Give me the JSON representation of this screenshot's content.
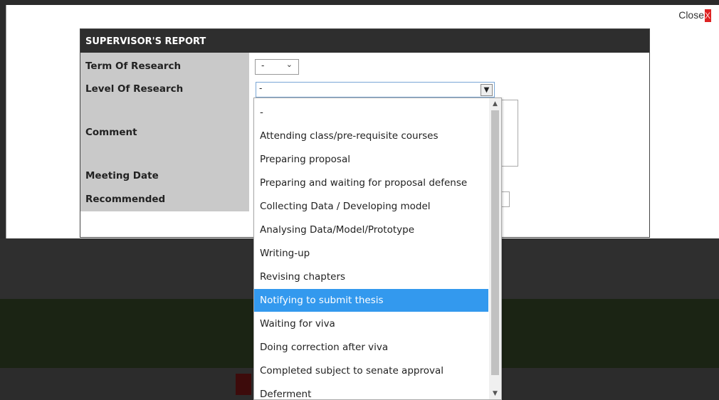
{
  "modal": {
    "close_label": "Close",
    "close_icon": "X"
  },
  "report": {
    "title": "SUPERVISOR'S REPORT",
    "labels": {
      "term": "Term Of Research",
      "level": "Level Of Research",
      "comment": "Comment",
      "meeting_date": "Meeting Date",
      "recommended": "Recommended"
    },
    "term_select": {
      "value": "-",
      "icon": "chevron-down-icon"
    },
    "level_select": {
      "value": "-",
      "icon": "chevron-down-icon"
    }
  },
  "dropdown": {
    "selected_index": 8,
    "options": [
      "-",
      "Attending class/pre-requisite courses",
      "Preparing proposal",
      "Preparing and waiting for proposal defense",
      "Collecting Data / Developing model",
      "Analysing Data/Model/Prototype",
      "Writing-up",
      "Revising chapters",
      "Notifying to submit thesis",
      "Waiting for viva",
      "Doing correction after viva",
      "Completed subject to senate approval",
      "Deferment"
    ]
  },
  "colors": {
    "header_bg": "#2e2e2e",
    "label_column_bg": "#c9c9c9",
    "selected_option_bg": "#3399ee",
    "close_button": "#d22222"
  }
}
